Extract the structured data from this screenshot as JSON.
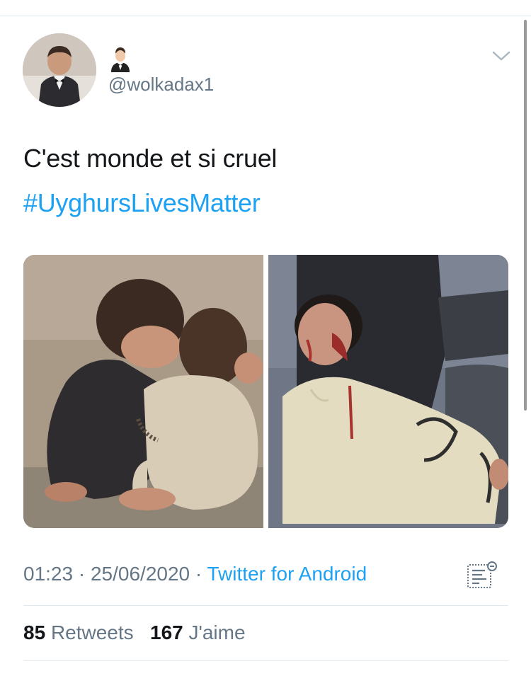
{
  "tweet": {
    "display_name_icon": "man-in-tuxedo-emoji",
    "handle": "@wolkadax1",
    "text": "C'est monde et si cruel",
    "hashtag": "#UyghursLivesMatter",
    "time": "01:23",
    "date": "25/06/2020",
    "separator": "·",
    "source": "Twitter for Android",
    "retweets_count": "85",
    "retweets_label": "Retweets",
    "likes_count": "167",
    "likes_label": "J'aime"
  },
  "colors": {
    "link": "#1da1f2",
    "secondary_text": "#657786",
    "primary_text": "#14171a",
    "divider": "#e1e8ed"
  }
}
